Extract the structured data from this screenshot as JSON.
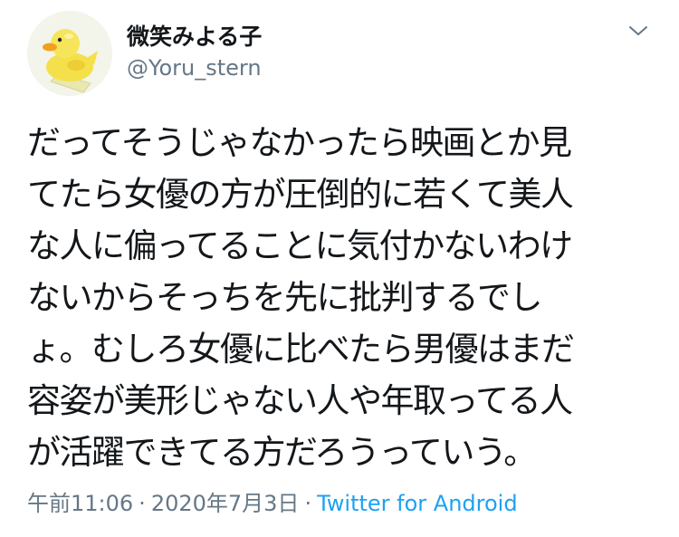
{
  "tweet": {
    "display_name": "微笑みよる子",
    "handle": "@Yoru_stern",
    "text": "だってそうじゃなかったら映画とか見\nてたら女優の方が圧倒的に若くて美人\nな人に偏ってることに気付かないわけ\nないからそっちを先に批判するでし\nょ。むしろ女優に比べたら男優はまだ\n容姿が美形じゃない人や年取ってる人\nが活躍できてる方だろうっていう。",
    "time": "午前11:06",
    "separator": "·",
    "date": "2020年7月3日",
    "source": "Twitter for Android"
  },
  "avatar": {
    "icon": "rubber-duck-icon",
    "background": "#f3f4ea",
    "duck_color": "#f6e24a"
  },
  "colors": {
    "text": "#14171a",
    "secondary": "#657786",
    "link": "#1da1f2"
  },
  "menu": {
    "icon": "chevron-down-icon"
  }
}
